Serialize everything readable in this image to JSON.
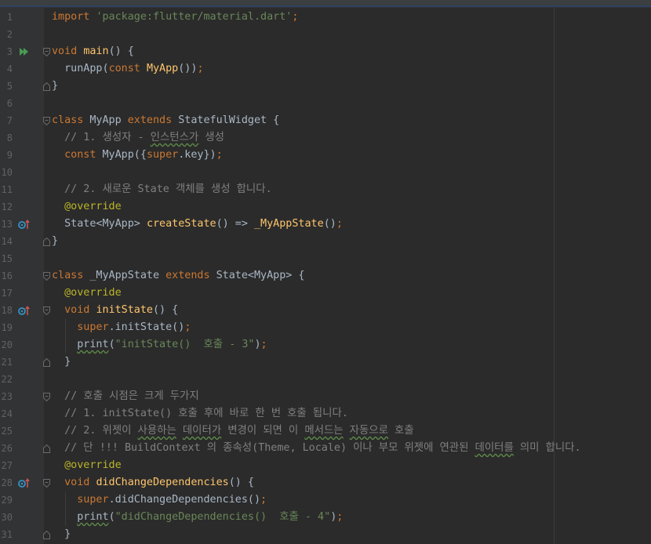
{
  "editor": {
    "lines": [
      {
        "n": "1",
        "tokens": [
          {
            "t": "import ",
            "c": "kw"
          },
          {
            "t": "'package:flutter/material.dart'",
            "c": "str"
          },
          {
            "t": ";",
            "c": "kw"
          }
        ]
      },
      {
        "n": "2",
        "tokens": []
      },
      {
        "n": "3",
        "tokens": [
          {
            "t": "void ",
            "c": "kw"
          },
          {
            "t": "main",
            "c": "fn"
          },
          {
            "t": "() {",
            "c": "pl"
          }
        ]
      },
      {
        "n": "4",
        "tokens": [
          {
            "t": "  runApp(",
            "c": "pl"
          },
          {
            "t": "const ",
            "c": "kw"
          },
          {
            "t": "MyApp",
            "c": "fn"
          },
          {
            "t": "())",
            "c": "pl"
          },
          {
            "t": ";",
            "c": "kw"
          }
        ]
      },
      {
        "n": "5",
        "tokens": [
          {
            "t": "}",
            "c": "pl"
          }
        ]
      },
      {
        "n": "6",
        "tokens": []
      },
      {
        "n": "7",
        "tokens": [
          {
            "t": "class ",
            "c": "kw"
          },
          {
            "t": "MyApp ",
            "c": "pl"
          },
          {
            "t": "extends ",
            "c": "kw"
          },
          {
            "t": "StatefulWidget {",
            "c": "pl"
          }
        ]
      },
      {
        "n": "8",
        "tokens": [
          {
            "t": "  // 1. 생성자 - ",
            "c": "cm"
          },
          {
            "t": "인스턴스가",
            "c": "cm wavy"
          },
          {
            "t": " 생성",
            "c": "cm"
          }
        ]
      },
      {
        "n": "9",
        "tokens": [
          {
            "t": "  ",
            "c": "pl"
          },
          {
            "t": "const ",
            "c": "kw"
          },
          {
            "t": "MyApp({",
            "c": "pl"
          },
          {
            "t": "super",
            "c": "kw"
          },
          {
            "t": ".key})",
            "c": "pl"
          },
          {
            "t": ";",
            "c": "kw"
          }
        ]
      },
      {
        "n": "10",
        "tokens": []
      },
      {
        "n": "11",
        "tokens": [
          {
            "t": "  // 2. 새로운 State 객체를 생성 합니다.",
            "c": "cm"
          }
        ]
      },
      {
        "n": "12",
        "tokens": [
          {
            "t": "  ",
            "c": "pl"
          },
          {
            "t": "@override",
            "c": "an"
          }
        ]
      },
      {
        "n": "13",
        "tokens": [
          {
            "t": "  State<MyApp> ",
            "c": "pl"
          },
          {
            "t": "createState",
            "c": "fn"
          },
          {
            "t": "() => ",
            "c": "pl"
          },
          {
            "t": "_MyAppState",
            "c": "fn"
          },
          {
            "t": "()",
            "c": "pl"
          },
          {
            "t": ";",
            "c": "kw"
          }
        ]
      },
      {
        "n": "14",
        "tokens": [
          {
            "t": "}",
            "c": "pl"
          }
        ]
      },
      {
        "n": "15",
        "tokens": []
      },
      {
        "n": "16",
        "tokens": [
          {
            "t": "class ",
            "c": "kw"
          },
          {
            "t": "_MyAppState ",
            "c": "pl"
          },
          {
            "t": "extends ",
            "c": "kw"
          },
          {
            "t": "State<MyApp> {",
            "c": "pl"
          }
        ]
      },
      {
        "n": "17",
        "tokens": [
          {
            "t": "  ",
            "c": "pl"
          },
          {
            "t": "@override",
            "c": "an"
          }
        ]
      },
      {
        "n": "18",
        "tokens": [
          {
            "t": "  ",
            "c": "pl"
          },
          {
            "t": "void ",
            "c": "kw"
          },
          {
            "t": "initState",
            "c": "fn"
          },
          {
            "t": "() {",
            "c": "pl"
          }
        ]
      },
      {
        "n": "19",
        "tokens": [
          {
            "t": "    ",
            "c": "pl"
          },
          {
            "t": "super",
            "c": "kw"
          },
          {
            "t": ".initState()",
            "c": "pl"
          },
          {
            "t": ";",
            "c": "kw"
          }
        ]
      },
      {
        "n": "20",
        "tokens": [
          {
            "t": "    ",
            "c": "pl"
          },
          {
            "t": "print",
            "c": "pl wavy"
          },
          {
            "t": "(",
            "c": "pl"
          },
          {
            "t": "\"initState()  호출 - 3\"",
            "c": "str"
          },
          {
            "t": ")",
            "c": "pl"
          },
          {
            "t": ";",
            "c": "kw"
          }
        ]
      },
      {
        "n": "21",
        "tokens": [
          {
            "t": "  }",
            "c": "pl"
          }
        ]
      },
      {
        "n": "22",
        "tokens": []
      },
      {
        "n": "23",
        "tokens": [
          {
            "t": "  // 호출 시점은 크게 두가지",
            "c": "cm"
          }
        ]
      },
      {
        "n": "24",
        "tokens": [
          {
            "t": "  // 1. initState() 호출 후에 바로 한 번 호출 됩니다.",
            "c": "cm"
          }
        ]
      },
      {
        "n": "25",
        "tokens": [
          {
            "t": "  // 2. 위젯이 ",
            "c": "cm"
          },
          {
            "t": "사용하는",
            "c": "cm wavy"
          },
          {
            "t": " ",
            "c": "cm"
          },
          {
            "t": "데이터가",
            "c": "cm wavy"
          },
          {
            "t": " 변경이 되면 이 ",
            "c": "cm"
          },
          {
            "t": "메서드는",
            "c": "cm wavy"
          },
          {
            "t": " ",
            "c": "cm"
          },
          {
            "t": "자동으로",
            "c": "cm wavy"
          },
          {
            "t": " 호출",
            "c": "cm"
          }
        ]
      },
      {
        "n": "26",
        "tokens": [
          {
            "t": "  // 단 !!! BuildContext 의 종속성(Theme, Locale) 이나 부모 위젯에 연관된 ",
            "c": "cm"
          },
          {
            "t": "데이터를",
            "c": "cm wavy"
          },
          {
            "t": " 의미 합니다.",
            "c": "cm"
          }
        ]
      },
      {
        "n": "27",
        "tokens": [
          {
            "t": "  ",
            "c": "pl"
          },
          {
            "t": "@override",
            "c": "an"
          }
        ]
      },
      {
        "n": "28",
        "tokens": [
          {
            "t": "  ",
            "c": "pl"
          },
          {
            "t": "void ",
            "c": "kw"
          },
          {
            "t": "didChangeDependencies",
            "c": "fn"
          },
          {
            "t": "() {",
            "c": "pl"
          }
        ]
      },
      {
        "n": "29",
        "tokens": [
          {
            "t": "    ",
            "c": "pl"
          },
          {
            "t": "super",
            "c": "kw"
          },
          {
            "t": ".didChangeDependencies()",
            "c": "pl"
          },
          {
            "t": ";",
            "c": "kw"
          }
        ]
      },
      {
        "n": "30",
        "tokens": [
          {
            "t": "    ",
            "c": "pl"
          },
          {
            "t": "print",
            "c": "pl wavy"
          },
          {
            "t": "(",
            "c": "pl"
          },
          {
            "t": "\"didChangeDependencies()  호출 - 4\"",
            "c": "str"
          },
          {
            "t": ")",
            "c": "pl"
          },
          {
            "t": ";",
            "c": "kw"
          }
        ]
      },
      {
        "n": "31",
        "tokens": [
          {
            "t": "  }",
            "c": "pl"
          }
        ]
      }
    ],
    "gutter_icons": [
      {
        "line": "3",
        "icon": "run-icon"
      },
      {
        "line": "13",
        "icon": "override-icon"
      },
      {
        "line": "18",
        "icon": "override-icon"
      },
      {
        "line": "28",
        "icon": "override-icon"
      }
    ],
    "fold_markers": [
      {
        "line": "3",
        "kind": "open"
      },
      {
        "line": "5",
        "kind": "close"
      },
      {
        "line": "7",
        "kind": "open"
      },
      {
        "line": "14",
        "kind": "close"
      },
      {
        "line": "16",
        "kind": "open"
      },
      {
        "line": "18",
        "kind": "open"
      },
      {
        "line": "21",
        "kind": "close"
      },
      {
        "line": "23",
        "kind": "open"
      },
      {
        "line": "26",
        "kind": "close"
      },
      {
        "line": "28",
        "kind": "open"
      },
      {
        "line": "31",
        "kind": "close"
      }
    ],
    "colors": {
      "background": "#2b2b2b",
      "gutter": "#313335",
      "keyword": "#cc7832",
      "string": "#6a8759",
      "function": "#ffc66d",
      "comment": "#808080",
      "annotation": "#bbb529",
      "plain": "#a9b7c6",
      "run_icon": "#499c54",
      "override_icon": "#3592c4"
    }
  }
}
